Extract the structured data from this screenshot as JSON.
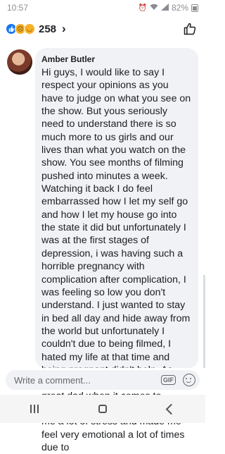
{
  "status_bar": {
    "time": "10:57",
    "battery": "82%"
  },
  "reactions": {
    "icons": [
      "like-reaction-icon",
      "sad-reaction-icon",
      "haha-reaction-icon"
    ],
    "count": "258"
  },
  "comment": {
    "author": "Amber Butler",
    "text": "Hi guys, I would like to say I respect your opinions as you have to judge on what you see on the show. But yous seriously need to understand there is so much more to us girls and our lives than what you watch on the show. You see months of filming pushed into minutes a week. Watching it back I do feel embarrassed how I let my self go and how I let my house go into the state it did but unfortunately I was at the first stages of depression, i was having such a horrible pregnancy with complication after complication, I was feeling so low you don't understand. I just wanted to stay in bed all day and hide away from the world but unfortunately I couldn't due to being filmed, I hated my life at that time and being pregnant didn't help. As much I respect Ste for being a great dad when it comes to Brooklyn, I'm sorry but he caused me a lot of stress and made me feel very emotional a lot of times due to"
  },
  "composer": {
    "placeholder": "Write a comment...",
    "gif_label": "GIF"
  },
  "colors": {
    "accent": "#1877f2",
    "bubble": "#f0f2f5"
  }
}
